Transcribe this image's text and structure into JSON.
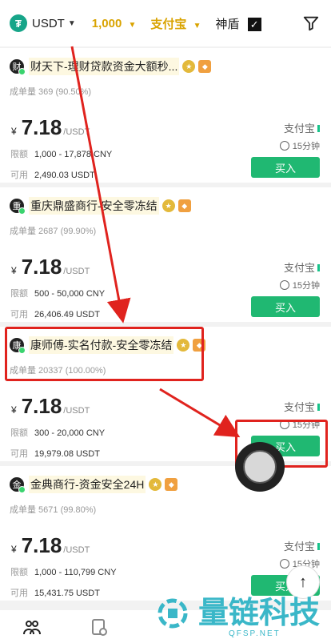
{
  "topbar": {
    "coin": "USDT",
    "amount": "1,000",
    "payment": "支付宝",
    "shield_label": "神盾"
  },
  "listings": [
    {
      "avatar_char": "财",
      "name": "财天下-理财贷款资金大额秒...",
      "orders": "成单量 369 (90.50%)",
      "currency_symbol": "¥",
      "price": "7.18",
      "unit": "/USDT",
      "limit_label": "限额",
      "limit": "1,000 - 17,878 CNY",
      "available_label": "可用",
      "available": "2,490.03 USDT",
      "method": "支付宝",
      "time": "15分钟",
      "buy_label": "买入"
    },
    {
      "avatar_char": "重",
      "name": "重庆鼎盛商行-安全零冻结",
      "orders": "成单量 2687 (99.90%)",
      "currency_symbol": "¥",
      "price": "7.18",
      "unit": "/USDT",
      "limit_label": "限额",
      "limit": "500 - 50,000 CNY",
      "available_label": "可用",
      "available": "26,406.49 USDT",
      "method": "支付宝",
      "time": "15分钟",
      "buy_label": "买入"
    },
    {
      "avatar_char": "康",
      "name": "康师傅-实名付款-安全零冻结",
      "orders": "成单量 20337 (100.00%)",
      "currency_symbol": "¥",
      "price": "7.18",
      "unit": "/USDT",
      "limit_label": "限额",
      "limit": "300 - 20,000 CNY",
      "available_label": "可用",
      "available": "19,979.08 USDT",
      "method": "支付宝",
      "time": "15分钟",
      "buy_label": "买入"
    },
    {
      "avatar_char": "金",
      "name": "金典商行-资金安全24H",
      "orders": "成单量 5671 (99.80%)",
      "currency_symbol": "¥",
      "price": "7.18",
      "unit": "/USDT",
      "limit_label": "限额",
      "limit": "1,000 - 110,799 CNY",
      "available_label": "可用",
      "available": "15,431.75 USDT",
      "method": "支付宝",
      "time": "15分钟",
      "buy_label": "买入"
    }
  ],
  "scroll_top_icon": "arrow-up-icon",
  "watermark": {
    "text": "量链科技",
    "sub": "QFSP.NET"
  },
  "colors": {
    "accent_gold": "#d9a300",
    "buy_green": "#20b872",
    "annotation_red": "#e0231e"
  }
}
